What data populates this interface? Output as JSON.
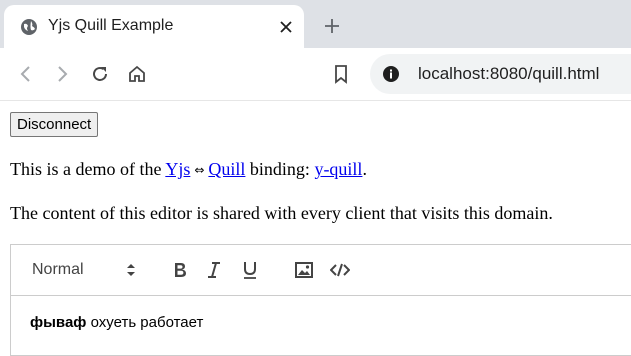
{
  "browser": {
    "tab_title": "Yjs Quill Example",
    "url": "localhost:8080/quill.html"
  },
  "page": {
    "disconnect_label": "Disconnect",
    "intro": {
      "prefix": "This is a demo of the",
      "link_yjs": "Yjs",
      "arrow": "⇔",
      "link_quill": "Quill",
      "middle": "binding:",
      "link_yquill": "y-quill",
      "suffix": "."
    },
    "shared_note": "The content of this editor is shared with every client that visits this domain."
  },
  "editor": {
    "heading_value": "Normal",
    "content_bold": "фываф",
    "content_rest": " охуеть работает"
  },
  "icons": {
    "favicon": "globe-icon",
    "tab_close": "close-icon",
    "new_tab": "plus-icon",
    "back": "back-arrow-icon",
    "forward": "forward-arrow-icon",
    "reload": "reload-icon",
    "home": "home-icon",
    "bookmark": "bookmark-icon",
    "site_info": "info-icon",
    "bold": "bold-icon",
    "italic": "italic-icon",
    "underline": "underline-icon",
    "image": "image-icon",
    "code": "code-icon"
  }
}
